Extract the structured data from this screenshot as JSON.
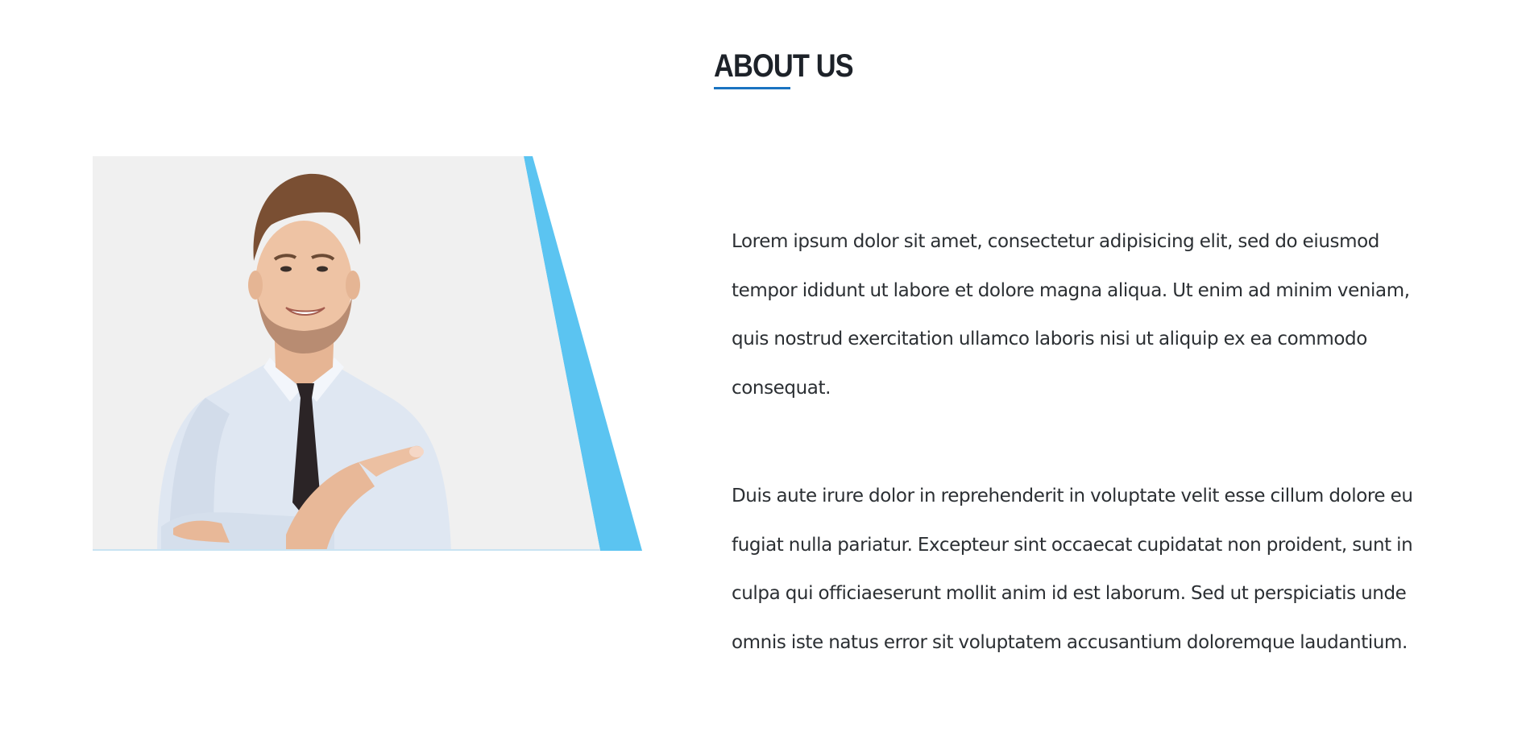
{
  "section": {
    "heading": "ABOUT US"
  },
  "image": {
    "subject": "man-in-shirt-and-tie-pointing-icon",
    "background_color": "#f0f0f0",
    "accent_color": "#5bc4f1"
  },
  "paragraphs": [
    "Lorem ipsum dolor sit amet, consectetur adipisicing elit, sed do eiusmod tempor ididunt ut labore et dolore magna aliqua. Ut enim ad minim veniam, quis nostrud exercitation ullamco laboris nisi ut aliquip ex ea commodo consequat.",
    "Duis aute irure dolor in reprehenderit in voluptate velit esse cillum dolore eu fugiat nulla pariatur. Excepteur sint occaecat cupidatat non proident, sunt in culpa qui officiaeserunt mollit anim id est laborum. Sed ut perspiciatis unde omnis iste natus error sit voluptatem accusantium doloremque laudantium."
  ],
  "colors": {
    "heading": "#1d2229",
    "underline": "#1a73c1",
    "text": "#2b2f33"
  }
}
